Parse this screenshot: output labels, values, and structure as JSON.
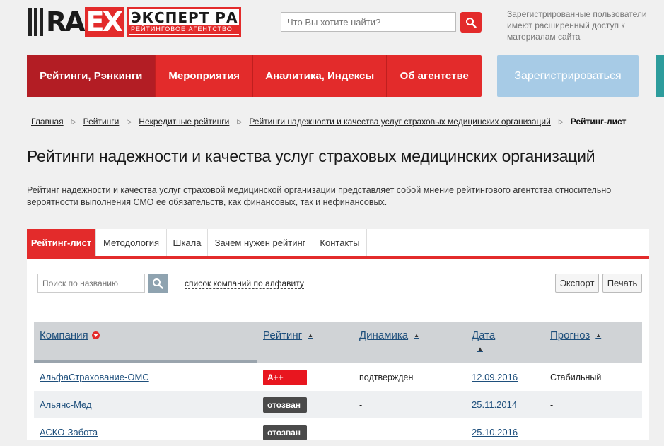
{
  "logo": {
    "part1": "RA",
    "part2": "EX",
    "line1": "ЭКСПЕРТ РА",
    "line2": "РЕЙТИНГОВОЕ АГЕНТСТВО"
  },
  "search": {
    "placeholder": "Что Вы хотите найти?"
  },
  "reg_note": "Зарегистрированные пользователи имеют расширенный доступ к материалам сайта",
  "nav": [
    {
      "label": "Рейтинги, Рэнкинги",
      "active": true
    },
    {
      "label": "Мероприятия",
      "active": false
    },
    {
      "label": "Аналитика, Индексы",
      "active": false
    },
    {
      "label": "Об агентстве",
      "active": false
    }
  ],
  "register_label": "Зарегистрироваться",
  "breadcrumb": {
    "items": [
      "Главная",
      "Рейтинги",
      "Некредитные рейтинги",
      "Рейтинги надежности и качества услуг страховых медицинских организаций"
    ],
    "current": "Рейтинг-лист"
  },
  "page_title": "Рейтинги надежности и качества услуг страховых медицинских организаций",
  "description": "Рейтинг надежности и качества услуг страховой медицинской организации представляет собой мнение рейтингового агентства относительно вероятности выполнения СМО ее обязательств, как финансовых, так и нефинансовых.",
  "tabs": [
    {
      "label": "Рейтинг-лист",
      "active": true
    },
    {
      "label": "Методология",
      "active": false
    },
    {
      "label": "Шкала",
      "active": false
    },
    {
      "label": "Зачем нужен рейтинг",
      "active": false
    },
    {
      "label": "Контакты",
      "active": false
    }
  ],
  "filter": {
    "placeholder": "Поиск по названию",
    "alpha_link": "список компаний по алфавиту",
    "export_label": "Экспорт",
    "print_label": "Печать"
  },
  "table": {
    "columns": [
      "Компания",
      "Рейтинг",
      "Динамика",
      "Дата",
      "Прогноз"
    ],
    "rows": [
      {
        "company": "АльфаСтрахование-ОМС",
        "rating": "A++",
        "rating_color": "#e8161f",
        "dynamics": "подтвержден",
        "date": "12.09.2016",
        "forecast": "Стабильный"
      },
      {
        "company": "Альянс-Мед",
        "rating": "отозван",
        "rating_color": "#4a4a4a",
        "dynamics": "-",
        "date": "25.11.2014",
        "forecast": "-"
      },
      {
        "company": "АСКО-Забота",
        "rating": "отозван",
        "rating_color": "#4a4a4a",
        "dynamics": "-",
        "date": "25.10.2016",
        "forecast": "-"
      }
    ]
  },
  "colors": {
    "accent": "#e32b2b",
    "nav_active": "#b31d24",
    "register": "#a7cbe6",
    "link": "#1e4f7c"
  }
}
